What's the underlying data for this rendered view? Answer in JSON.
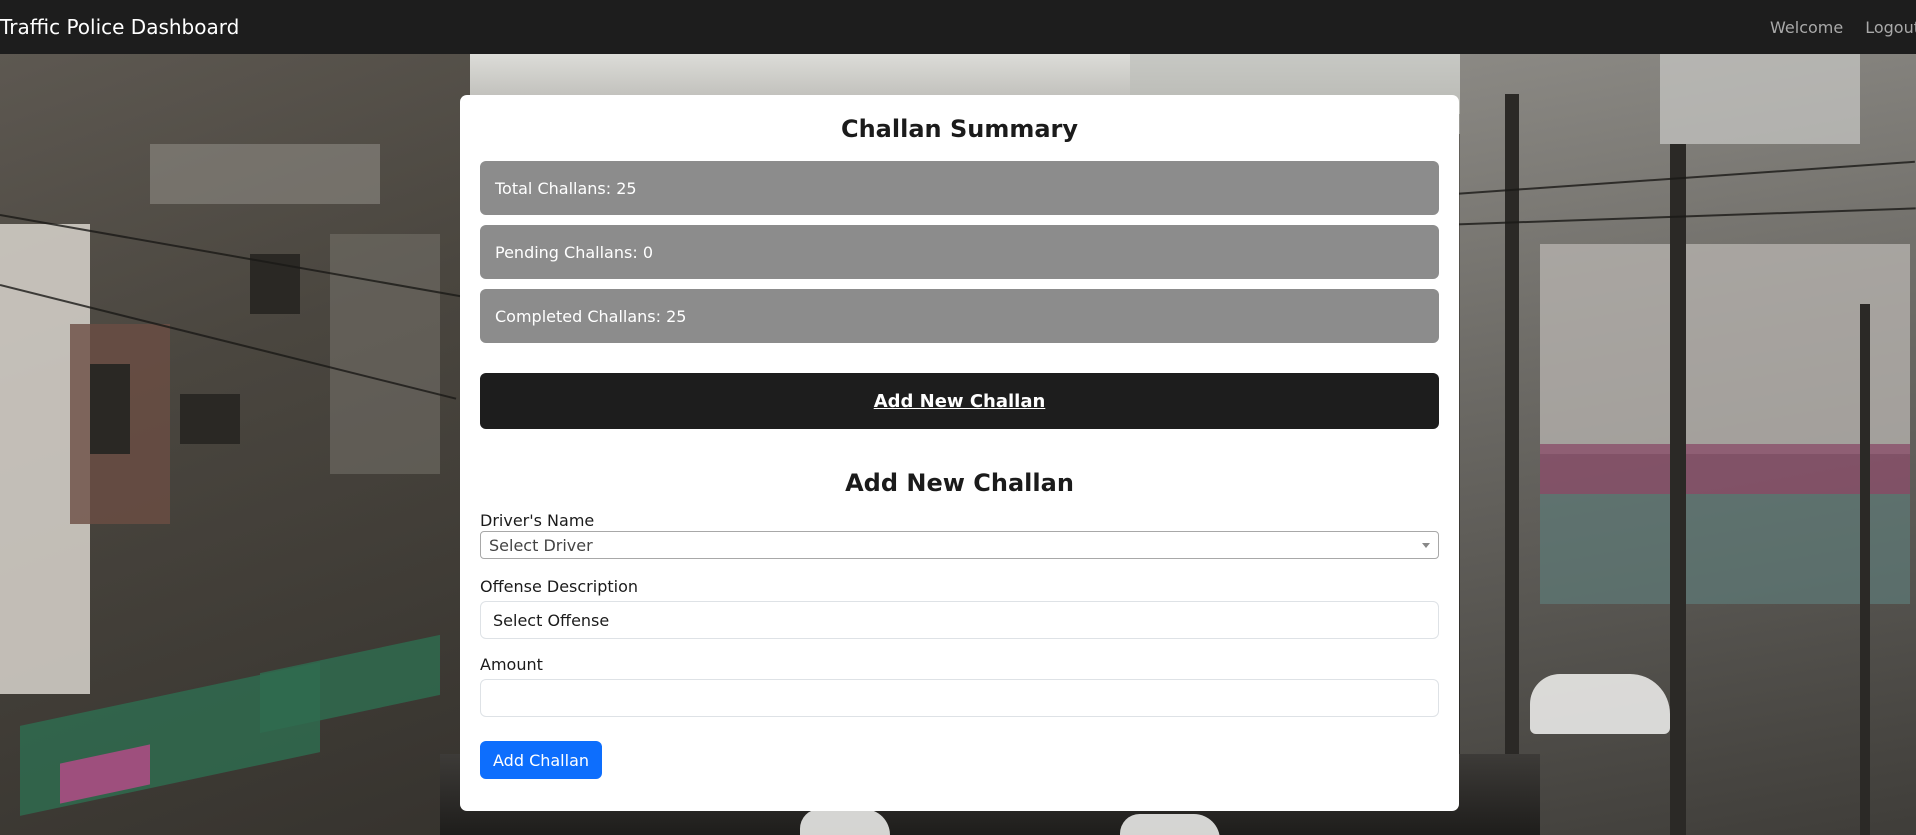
{
  "navbar": {
    "brand": "Traffic Police Dashboard",
    "welcome": "Welcome",
    "logout": "Logout"
  },
  "summary": {
    "title": "Challan Summary",
    "total": "Total Challans: 25",
    "pending": "Pending Challans: 0",
    "completed": "Completed Challans: 25"
  },
  "add_button_label": "Add New Challan",
  "form": {
    "title": "Add New Challan",
    "driver_label": "Driver's Name",
    "driver_selected": "Select Driver",
    "offense_label": "Offense Description",
    "offense_selected": "Select Offense",
    "amount_label": "Amount",
    "amount_value": "",
    "submit_label": "Add Challan"
  },
  "colors": {
    "navbar_bg": "#1d1d1d",
    "stat_bg": "#8c8c8c",
    "primary": "#0d6efd"
  }
}
